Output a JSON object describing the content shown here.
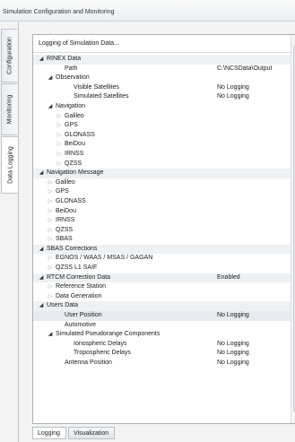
{
  "window": {
    "title": "Simulation Configuration and Monitoring"
  },
  "side_tabs": [
    "Configuration",
    "Monitoring",
    "Data Logging"
  ],
  "tree": {
    "header": "Logging of Simulation Data...",
    "rows": [
      {
        "label": "RINEX Data",
        "level": 0,
        "arrow": "expanded",
        "value": "",
        "style": "group"
      },
      {
        "label": "Path",
        "level": 2,
        "arrow": "none",
        "value": "C:\\NCSData\\Output",
        "style": ""
      },
      {
        "label": "Observation",
        "level": 1,
        "arrow": "expanded",
        "value": "",
        "style": ""
      },
      {
        "label": "Visible Satellites",
        "level": 3,
        "arrow": "none",
        "value": "No Logging",
        "style": ""
      },
      {
        "label": "Simulated Satellites",
        "level": 3,
        "arrow": "none",
        "value": "No Logging",
        "style": ""
      },
      {
        "label": "Navigation",
        "level": 1,
        "arrow": "expanded",
        "value": "",
        "style": ""
      },
      {
        "label": "Galileo",
        "level": 2,
        "arrow": "collapsed",
        "value": "",
        "style": ""
      },
      {
        "label": "GPS",
        "level": 2,
        "arrow": "collapsed",
        "value": "",
        "style": ""
      },
      {
        "label": "GLONASS",
        "level": 2,
        "arrow": "collapsed",
        "value": "",
        "style": ""
      },
      {
        "label": "BeiDou",
        "level": 2,
        "arrow": "collapsed",
        "value": "",
        "style": ""
      },
      {
        "label": "IRNSS",
        "level": 2,
        "arrow": "collapsed",
        "value": "",
        "style": ""
      },
      {
        "label": "QZSS",
        "level": 2,
        "arrow": "collapsed",
        "value": "",
        "style": ""
      },
      {
        "label": "Navigation Message",
        "level": 0,
        "arrow": "expanded",
        "value": "",
        "style": "group"
      },
      {
        "label": "Galileo",
        "level": 1,
        "arrow": "collapsed",
        "value": "",
        "style": ""
      },
      {
        "label": "GPS",
        "level": 1,
        "arrow": "collapsed",
        "value": "",
        "style": ""
      },
      {
        "label": "GLONASS",
        "level": 1,
        "arrow": "collapsed",
        "value": "",
        "style": ""
      },
      {
        "label": "BeiDou",
        "level": 1,
        "arrow": "collapsed",
        "value": "",
        "style": ""
      },
      {
        "label": "IRNSS",
        "level": 1,
        "arrow": "collapsed",
        "value": "",
        "style": ""
      },
      {
        "label": "QZSS",
        "level": 1,
        "arrow": "collapsed",
        "value": "",
        "style": ""
      },
      {
        "label": "SBAS",
        "level": 1,
        "arrow": "collapsed",
        "value": "",
        "style": ""
      },
      {
        "label": "SBAS Corrections",
        "level": 0,
        "arrow": "expanded",
        "value": "",
        "style": "group"
      },
      {
        "label": "EGNOS / WAAS / MSAS / GAGAN",
        "level": 1,
        "arrow": "collapsed",
        "value": "",
        "style": ""
      },
      {
        "label": "QZSS L1 SAIF",
        "level": 1,
        "arrow": "collapsed",
        "value": "",
        "style": ""
      },
      {
        "label": "RTCM Correction Data",
        "level": 0,
        "arrow": "expanded",
        "value": "Enabled",
        "style": "group"
      },
      {
        "label": "Reference Station",
        "level": 1,
        "arrow": "collapsed",
        "value": "",
        "style": ""
      },
      {
        "label": "Data Generation",
        "level": 1,
        "arrow": "collapsed",
        "value": "",
        "style": ""
      },
      {
        "label": "Users Data",
        "level": 0,
        "arrow": "expanded",
        "value": "",
        "style": "group"
      },
      {
        "label": "User Position",
        "level": 2,
        "arrow": "none",
        "value": "No Logging",
        "style": "hl"
      },
      {
        "label": "Automotive",
        "level": 2,
        "arrow": "none",
        "value": "",
        "style": ""
      },
      {
        "label": "Simulated Pseudorange Components",
        "level": 1,
        "arrow": "expanded",
        "value": "",
        "style": ""
      },
      {
        "label": "Ionospheric Delays",
        "level": 3,
        "arrow": "none",
        "value": "No Logging",
        "style": ""
      },
      {
        "label": "Tropospheric Delays",
        "level": 3,
        "arrow": "none",
        "value": "No Logging",
        "style": ""
      },
      {
        "label": "Antenna Position",
        "level": 2,
        "arrow": "none",
        "value": "No Logging",
        "style": ""
      }
    ]
  },
  "bottom_tabs": [
    "Logging",
    "Visualization"
  ]
}
